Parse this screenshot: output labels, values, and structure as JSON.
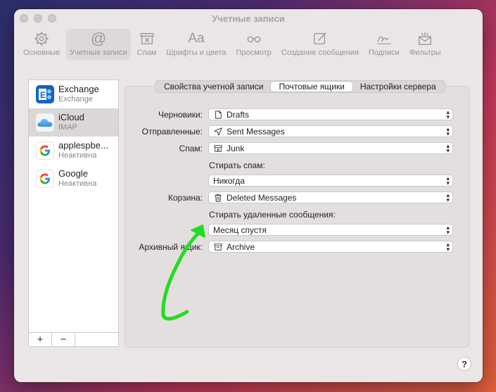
{
  "window": {
    "title": "Учетные записи"
  },
  "toolbar": {
    "items": [
      {
        "label": "Основные",
        "icon": "gear-icon"
      },
      {
        "label": "Учетные записи",
        "icon": "at-icon",
        "glyph": "@"
      },
      {
        "label": "Спам",
        "icon": "junk-tray-icon"
      },
      {
        "label": "Шрифты и цвета",
        "icon": "fonts-icon",
        "glyph": "Aa"
      },
      {
        "label": "Просмотр",
        "icon": "glasses-icon"
      },
      {
        "label": "Создание сообщения",
        "icon": "compose-icon"
      },
      {
        "label": "Подписи",
        "icon": "signature-icon"
      },
      {
        "label": "Фильтры",
        "icon": "filters-icon"
      }
    ]
  },
  "sidebar": {
    "accounts": [
      {
        "name": "Exchange",
        "sub": "Exchange",
        "icon": "exchange-icon"
      },
      {
        "name": "iCloud",
        "sub": "IMAP",
        "icon": "icloud-icon"
      },
      {
        "name": "applespbe...",
        "sub": "Неактивна",
        "icon": "google-icon"
      },
      {
        "name": "Google",
        "sub": "Неактивна",
        "icon": "google-icon"
      }
    ],
    "add_label": "+",
    "remove_label": "−"
  },
  "tabs": [
    {
      "label": "Свойства учетной записи"
    },
    {
      "label": "Почтовые ящики"
    },
    {
      "label": "Настройки сервера"
    }
  ],
  "form": {
    "drafts_label": "Черновики:",
    "drafts_value": "Drafts",
    "sent_label": "Отправленные:",
    "sent_value": "Sent Messages",
    "spam_label": "Спам:",
    "spam_value": "Junk",
    "erase_spam_label": "Стирать спам:",
    "erase_spam_value": "Никогда",
    "trash_label": "Корзина:",
    "trash_value": "Deleted Messages",
    "erase_deleted_label": "Стирать удаленные сообщения:",
    "erase_deleted_value": "Месяц спустя",
    "archive_label": "Архивный ящик:",
    "archive_value": "Archive"
  },
  "help_label": "?",
  "colors": {
    "arrow": "#22dd22",
    "window_bg": "#ebe6e6",
    "exchange_blue": "#1565c0"
  }
}
